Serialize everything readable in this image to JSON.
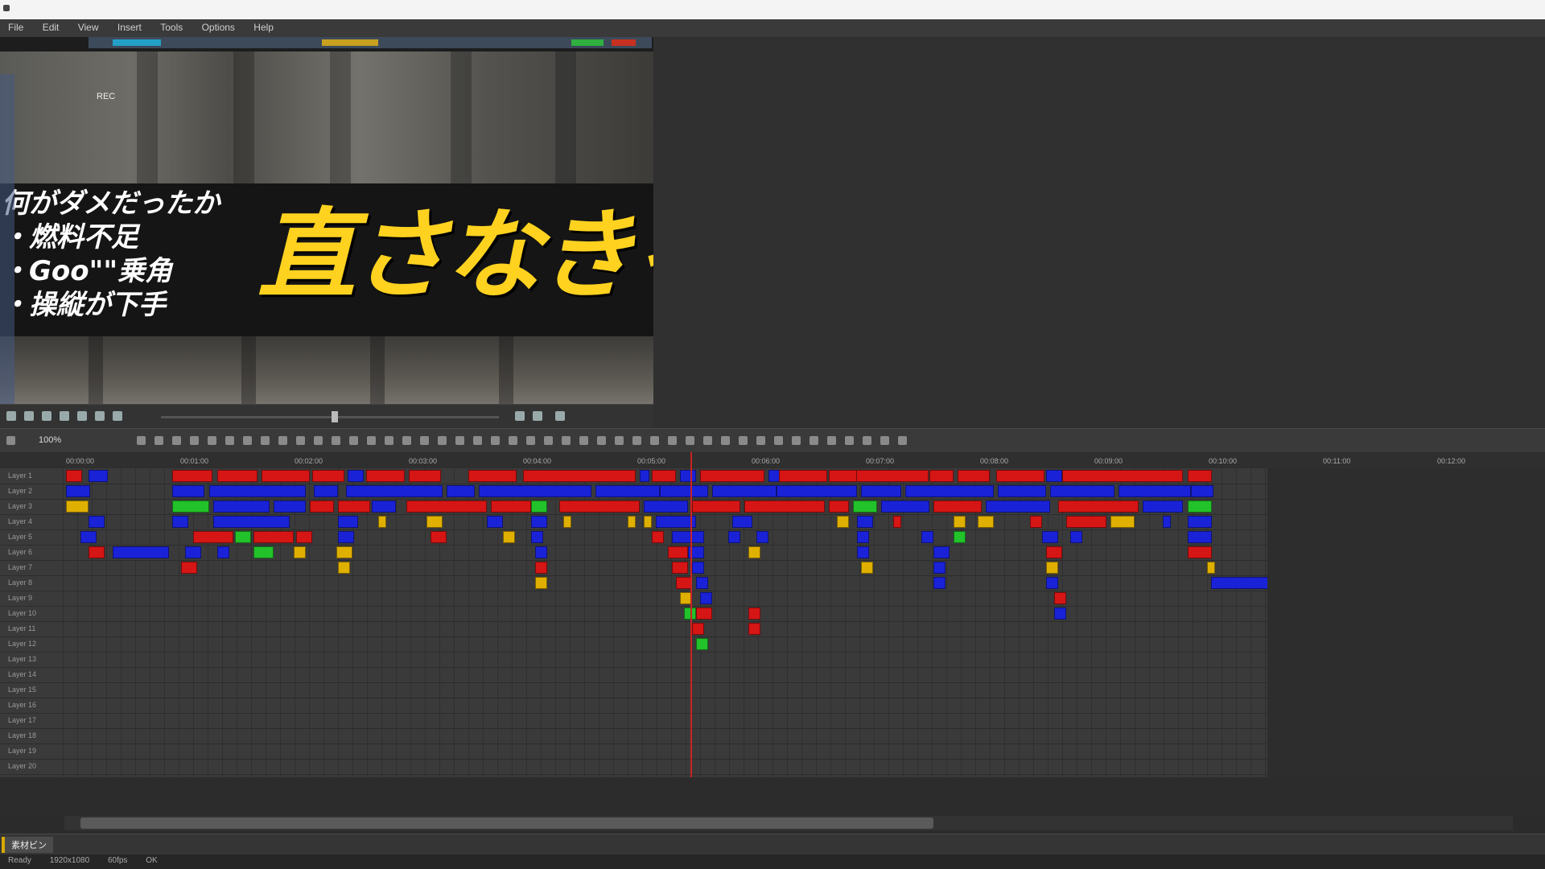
{
  "window": {
    "title": ""
  },
  "menu": {
    "items": [
      "File",
      "Edit",
      "View",
      "Insert",
      "Tools",
      "Options",
      "Help"
    ]
  },
  "preview": {
    "caption_lines": [
      "何がダメだったか",
      "・燃料不足",
      "・Goo\"\"乗角",
      "・操縦が下手"
    ],
    "caption_big": "直さなきゃ！",
    "overlay_label": "REC"
  },
  "timeline": {
    "zoom_label": "100%",
    "ruler_ticks": [
      "00:00:00",
      "00:01:00",
      "00:02:00",
      "00:03:00",
      "00:04:00",
      "00:05:00",
      "00:06:00",
      "00:07:00",
      "00:08:00",
      "00:09:00",
      "00:10:00",
      "00:11:00",
      "00:12:00"
    ],
    "track_labels": [
      "Layer 1",
      "Layer 2",
      "Layer 3",
      "Layer 4",
      "Layer 5",
      "Layer 6",
      "Layer 7",
      "Layer 8",
      "Layer 9",
      "Layer 10",
      "Layer 11",
      "Layer 12",
      "Layer 13",
      "Layer 14",
      "Layer 15",
      "Layer 16",
      "Layer 17",
      "Layer 18",
      "Layer 19",
      "Layer 20"
    ],
    "clip_colors": {
      "red": "#d61515",
      "blue": "#1a22d8",
      "green": "#22c22a",
      "yellow": "#e0b000"
    }
  },
  "bin": {
    "tab_label": "素材ビン"
  },
  "status": {
    "items": [
      "Ready",
      "1920x1080",
      "60fps",
      "OK"
    ]
  }
}
